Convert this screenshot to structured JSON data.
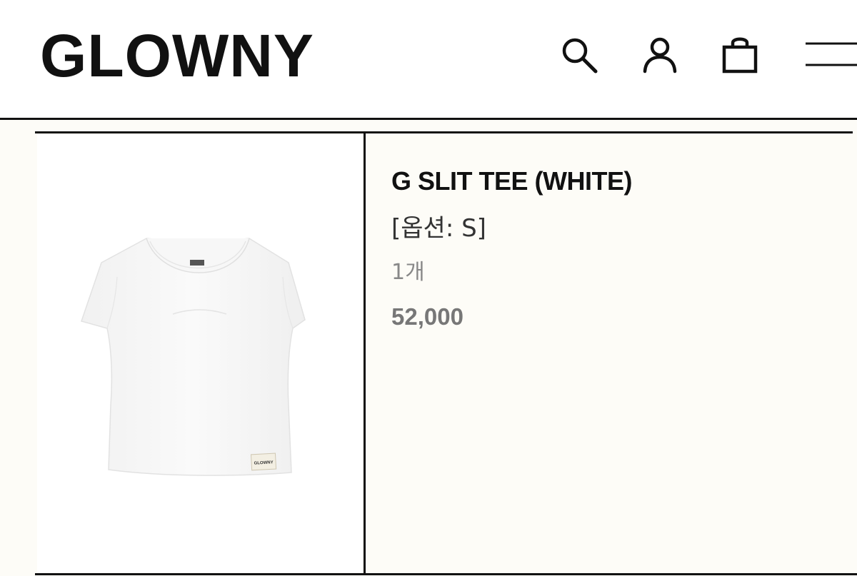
{
  "header": {
    "logo": "GLOWNY",
    "icons": {
      "search": "search-icon",
      "account": "user-icon",
      "cart": "shopping-bag-icon",
      "menu": "hamburger-menu-icon"
    }
  },
  "order_item": {
    "product_name": "G SLIT TEE (WHITE)",
    "option": "[옵션: S]",
    "quantity": "1개",
    "price": "52,000",
    "image": {
      "subject": "white cap-sleeve tee",
      "label_text": "GLOWNY"
    }
  },
  "colors": {
    "background": "#fdfcf7",
    "header_background": "#ffffff",
    "text": "#111111",
    "price": "#777777",
    "quantity": "#888888"
  }
}
